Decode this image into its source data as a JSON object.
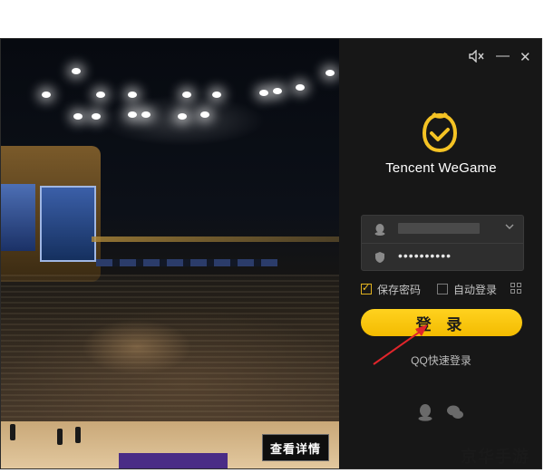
{
  "window": {
    "controls": {
      "mute_icon": "speaker-muted-icon",
      "minimize": "—",
      "close": "✕"
    }
  },
  "promo": {
    "details_button": "查看详情"
  },
  "login": {
    "brand": "Tencent WeGame",
    "password_mask": "••••••••••",
    "remember_password": "保存密码",
    "remember_checked": true,
    "auto_login": "自动登录",
    "auto_login_checked": false,
    "login_button": "登 录",
    "qq_quick_login": "QQ快速登录",
    "social_icons": [
      "qq-penguin-icon",
      "wechat-icon"
    ]
  },
  "colors": {
    "accent": "#f5c324",
    "panel_bg": "#171717",
    "annotation_arrow": "#e0252b"
  },
  "watermark": "京华手游"
}
